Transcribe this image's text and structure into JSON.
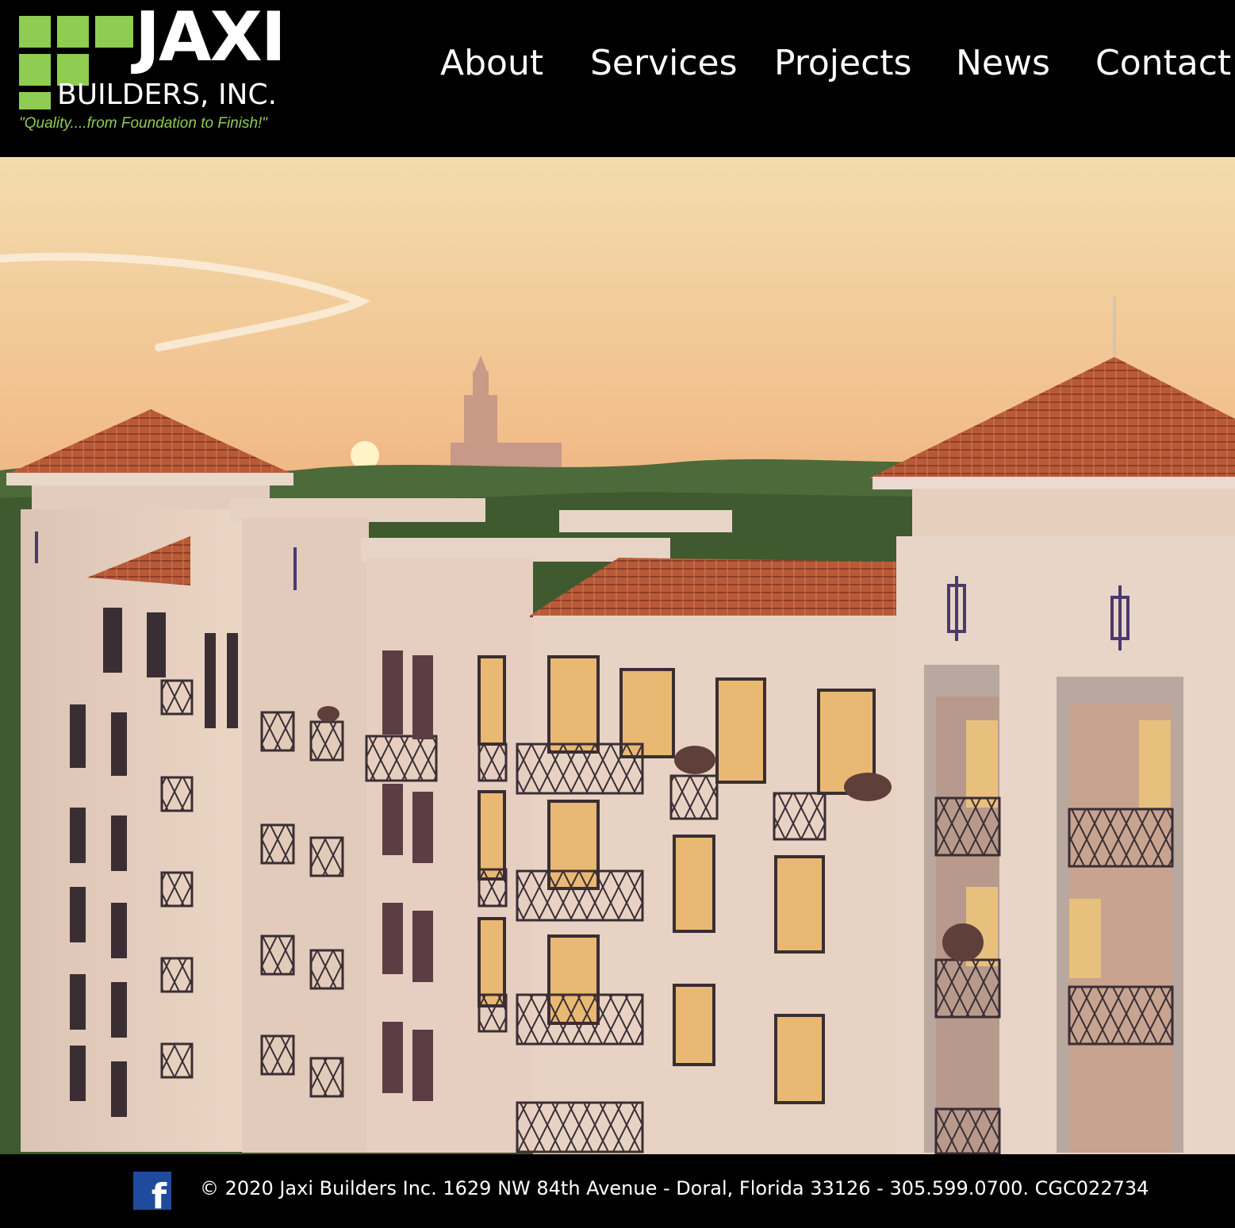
{
  "header": {
    "logo": {
      "wordmark": "JAXI",
      "subtitle": "BUILDERS, INC.",
      "tagline": "\"Quality....from Foundation to Finish!\"",
      "accent_color": "#8fcc52"
    },
    "nav": [
      "About",
      "Services",
      "Projects",
      "News",
      "Contact"
    ]
  },
  "hero": {
    "image": "rendering of a Mediterranean-style residential building at sunset"
  },
  "footer": {
    "social_icon": "facebook-icon",
    "social_color": "#1f4b9e",
    "text": "© 2020 Jaxi Builders Inc. 1629 NW 84th Avenue - Doral, Florida 33126  -  305.599.0700.  CGC022734"
  }
}
